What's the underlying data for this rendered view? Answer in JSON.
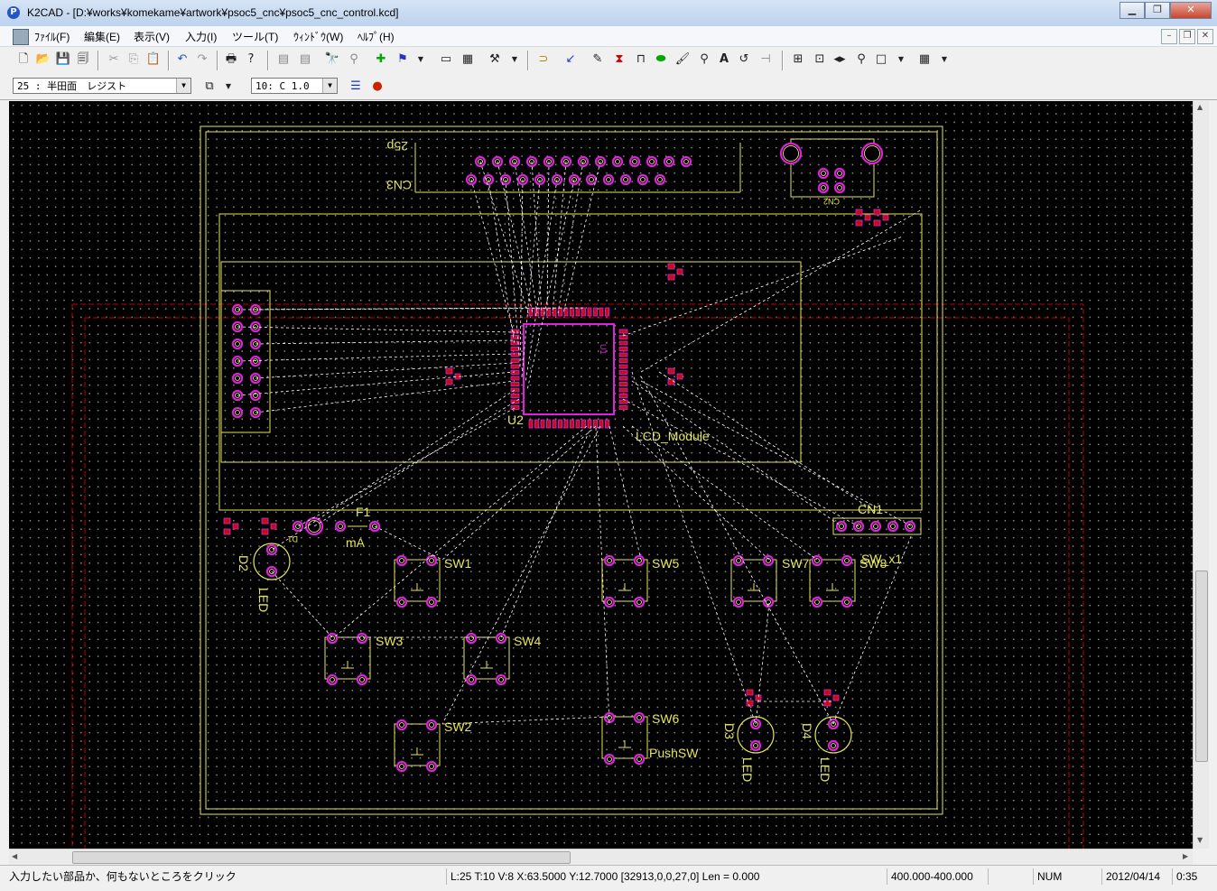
{
  "window": {
    "title": "K2CAD - [D:¥works¥komekame¥artwork¥psoc5_cnc¥psoc5_cnc_control.kcd]",
    "app_icon_letter": "P"
  },
  "menu": [
    {
      "label": "ﾌｧｲﾙ(F)"
    },
    {
      "label": "編集(E)"
    },
    {
      "label": "表示(V)"
    },
    {
      "label": "入力(I)"
    },
    {
      "label": "ツール(T)"
    },
    {
      "label": "ｳｨﾝﾄﾞｳ(W)"
    },
    {
      "label": "ﾍﾙﾌﾟ(H)"
    }
  ],
  "toolbar": {
    "layer_select": "25 : 半田面　レジスト",
    "grid_select": "10: C 1.0"
  },
  "pcb": {
    "labels": {
      "cn3": "CN3",
      "cn3_pins": "25p",
      "cn2": "CN2",
      "u2": "U2",
      "u1": "U1",
      "lcd": "LCD_Module",
      "cn1": "CN1",
      "f1": "F1",
      "ma": "mA",
      "d1": "D1",
      "d2": "D2",
      "d2_type": "LED",
      "d3": "D3",
      "d3_type": "LED",
      "d4": "D4",
      "d4_type": "LED",
      "sw1": "SW1",
      "sw2": "SW2",
      "sw3": "SW3",
      "sw4": "SW4",
      "sw5": "SW5",
      "sw6": "SW6",
      "sw6_type": "PushSW",
      "sw7": "SW7",
      "sw8": "SW8",
      "sw_x1": "SW_x1"
    }
  },
  "status": {
    "hint": "入力したい部品か、何もないところをクリック",
    "coords": "L:25 T:10 V:8 X:63.5000 Y:12.7000 [32913,0,0,27,0] Len = 0.000",
    "size": "400.000-400.000",
    "num": "NUM",
    "date": "2012/04/14",
    "time": "0:35"
  },
  "colors": {
    "silk": "#e6e65a",
    "pad_outer": "#e020e0",
    "pad_inner": "#ffff80",
    "ratsnest": "#ffffff",
    "outline_red": "#c00000",
    "canvas": "#000000"
  }
}
